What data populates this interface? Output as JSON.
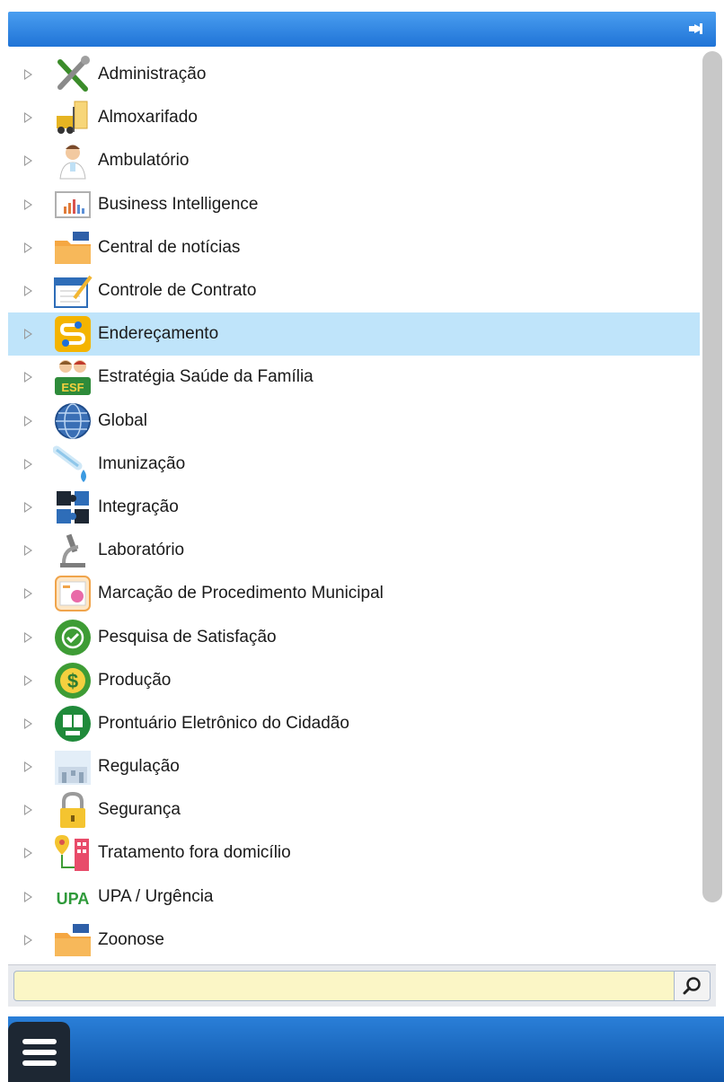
{
  "menu": {
    "items": [
      {
        "label": "Administração",
        "icon": "wrench-screwdriver-icon",
        "selected": false
      },
      {
        "label": "Almoxarifado",
        "icon": "forklift-icon",
        "selected": false
      },
      {
        "label": "Ambulatório",
        "icon": "doctor-icon",
        "selected": false
      },
      {
        "label": "Business Intelligence",
        "icon": "bar-chart-icon",
        "selected": false
      },
      {
        "label": "Central de notícias",
        "icon": "folder-news-icon",
        "selected": false
      },
      {
        "label": "Controle de Contrato",
        "icon": "calendar-pen-icon",
        "selected": false
      },
      {
        "label": "Endereçamento",
        "icon": "route-icon",
        "selected": true
      },
      {
        "label": "Estratégia Saúde da Família",
        "icon": "esf-family-icon",
        "selected": false
      },
      {
        "label": "Global",
        "icon": "globe-icon",
        "selected": false
      },
      {
        "label": "Imunização",
        "icon": "syringe-drop-icon",
        "selected": false
      },
      {
        "label": "Integração",
        "icon": "puzzle-icon",
        "selected": false
      },
      {
        "label": "Laboratório",
        "icon": "microscope-icon",
        "selected": false
      },
      {
        "label": "Marcação de Procedimento Municipal",
        "icon": "schedule-procedure-icon",
        "selected": false
      },
      {
        "label": "Pesquisa de Satisfação",
        "icon": "check-badge-icon",
        "selected": false
      },
      {
        "label": "Produção",
        "icon": "dollar-coin-icon",
        "selected": false
      },
      {
        "label": "Prontuário Eletrônico do Cidadão",
        "icon": "pec-book-icon",
        "selected": false
      },
      {
        "label": "Regulação",
        "icon": "hospital-icon",
        "selected": false
      },
      {
        "label": "Segurança",
        "icon": "padlock-icon",
        "selected": false
      },
      {
        "label": "Tratamento fora domicílio",
        "icon": "location-building-icon",
        "selected": false
      },
      {
        "label": "UPA / Urgência",
        "icon": "upa-logo-icon",
        "selected": false
      },
      {
        "label": "Zoonose",
        "icon": "folder-zoonose-icon",
        "selected": false
      }
    ]
  },
  "search": {
    "value": "",
    "placeholder": ""
  },
  "upa_logo_text": "UPA",
  "colors": {
    "header": "#2a84e3",
    "selected_row": "#bfe4fa",
    "search_bg": "#fbf6c6",
    "bottom_bar": "#1a6bc4"
  }
}
